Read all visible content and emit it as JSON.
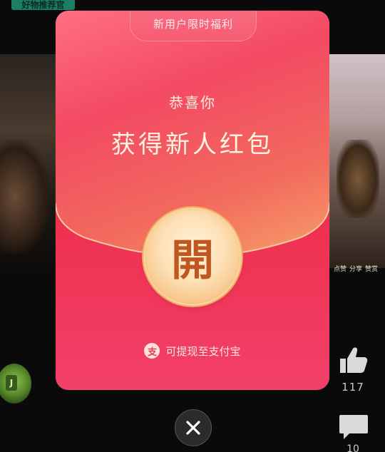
{
  "background": {
    "tag_text": "好物推荐官",
    "right_caption": [
      "点赞",
      "分享",
      "赞赏"
    ],
    "avatar_glyph": "J",
    "like_count": "117",
    "comment_count": "10",
    "icons": [
      "thumbs-up-icon",
      "comment-icon"
    ]
  },
  "envelope": {
    "banner": "新用户限时福利",
    "congrats": "恭喜你",
    "title": "获得新人红包",
    "open_label": "開",
    "withdraw_text": "可提现至支付宝",
    "alipay_glyph": "支"
  },
  "close": {
    "icon": "close-icon"
  },
  "colors": {
    "envelope_red": "#ec2a4a",
    "flap_pink": "#ff6f83",
    "button_gold": "#f7c58a",
    "open_text": "#c2561f"
  }
}
